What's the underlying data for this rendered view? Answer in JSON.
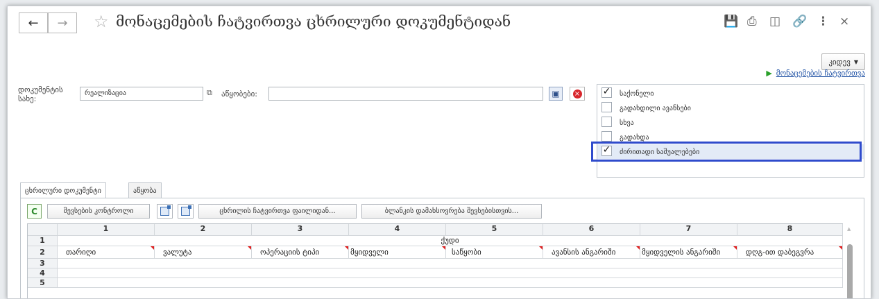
{
  "window": {
    "title": "მონაცემების ჩატვირთვა ცხრილური დოკუმენტიდან",
    "more_label": "კიდევ",
    "load_link": "მონაცემების ჩატვირთვა"
  },
  "form": {
    "doc_type_label": "დოკუმენტის სახე:",
    "doc_type_value": "რეალიზაცია",
    "settings_label": "აწყობები:",
    "settings_value": ""
  },
  "checklist": [
    {
      "label": "საქონელი",
      "checked": true
    },
    {
      "label": "გადახდილი ავანსები",
      "checked": false
    },
    {
      "label": "სხვა",
      "checked": false
    },
    {
      "label": "გადახდა",
      "checked": false
    },
    {
      "label": "ძირითადი საშუალებები",
      "checked": true
    }
  ],
  "tabs": [
    "ცხრილური დოკუმენტი",
    "აწყობა"
  ],
  "toolbar": {
    "check_fill": "შევსების კონტროლი",
    "load_from_file": "ცხრილის ჩატვირთვა ფაილიდან...",
    "save_template": "ბლანკის დამახსოვრება შევსებისთვის..."
  },
  "grid": {
    "columns": [
      "1",
      "2",
      "3",
      "4",
      "5",
      "6",
      "7",
      "8"
    ],
    "rows": [
      "1",
      "2",
      "3",
      "4",
      "5"
    ],
    "group_header": "ქუდი",
    "headers": [
      "თარიღი",
      "ვალუტა",
      "ოპერაციის ტიპი",
      "მყიდველი",
      "საწყობი",
      "ავანსის ანგარიში",
      "მყიდველის ანგარიში",
      "დღგ-ით დაბეგვრა"
    ]
  },
  "colors": {
    "highlight": "#2f4bcc",
    "link": "#2354a6",
    "cancel": "#d8262c"
  }
}
